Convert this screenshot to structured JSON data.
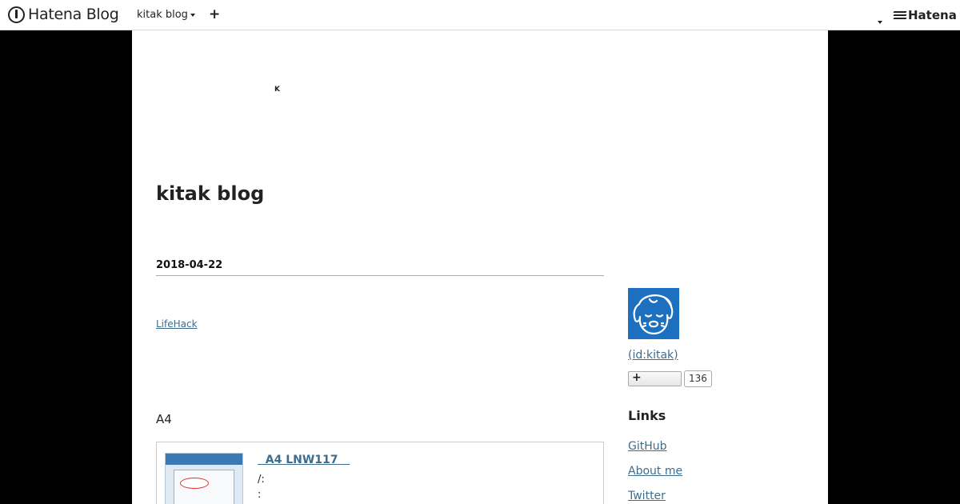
{
  "globalbar": {
    "logo_text": "Hatena Blog",
    "blog_menu_label": "kitak blog",
    "add_label": "+",
    "brand_text": "Hatena"
  },
  "header": {
    "small_mark": "K",
    "blog_title": "kitak blog"
  },
  "entry": {
    "date": "2018-04-22",
    "category": "LifeHack",
    "body_text": "A4",
    "embed": {
      "title": "  A4 LNW117   ",
      "line1": "/:",
      "line2": ":"
    }
  },
  "sidebar": {
    "profile_link": " (id:kitak)",
    "follow_icon": "+",
    "follower_count": "136",
    "links_title": "Links",
    "links": [
      "GitHub",
      "About me",
      "Twitter"
    ]
  },
  "colors": {
    "link": "#3d6d8e",
    "avatar_bg": "#1d6fbf",
    "page_bg": "#000000"
  }
}
